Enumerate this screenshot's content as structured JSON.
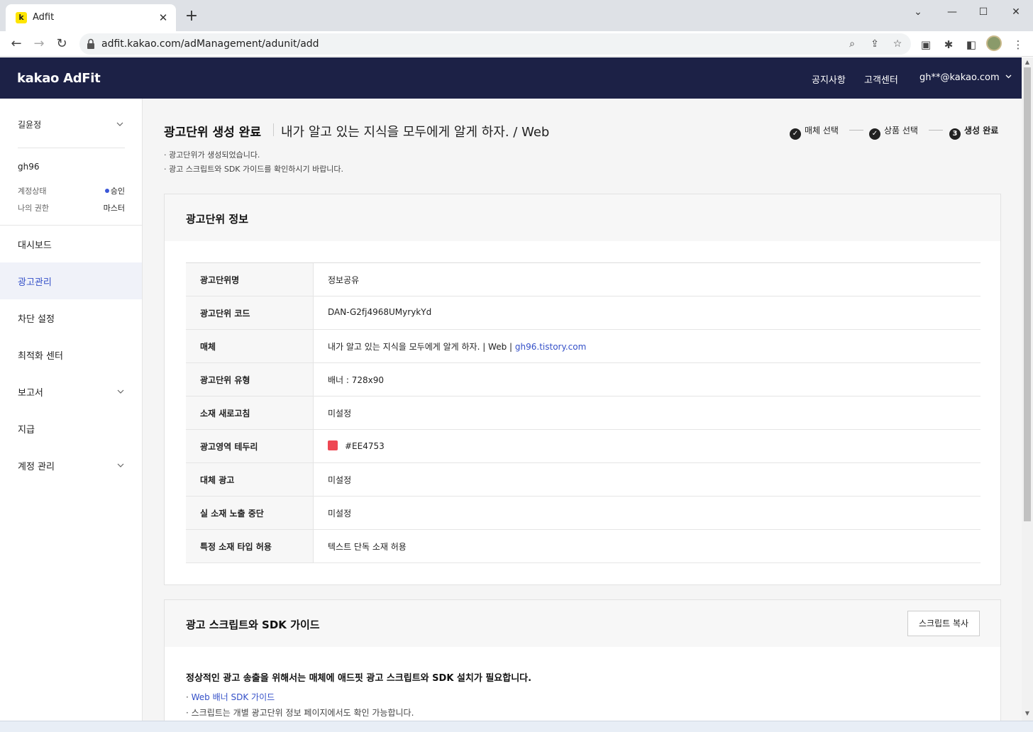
{
  "browser": {
    "tab_title": "Adfit",
    "tab_favicon": "k",
    "url": "adfit.kakao.com/adManagement/adunit/add"
  },
  "header": {
    "logo": "kakao AdFit",
    "notice_link": "공지사항",
    "support_link": "고객센터",
    "user_email": "gh**@kakao.com"
  },
  "sidebar": {
    "account_name": "길윤정",
    "user_id": "gh96",
    "status_label": "계정상태",
    "status_value": "승인",
    "role_label": "나의 권한",
    "role_value": "마스터",
    "menu": [
      {
        "label": "대시보드"
      },
      {
        "label": "광고관리"
      },
      {
        "label": "차단 설정"
      },
      {
        "label": "최적화 센터"
      },
      {
        "label": "보고서"
      },
      {
        "label": "지급"
      },
      {
        "label": "계정 관리"
      }
    ]
  },
  "page": {
    "title": "광고단위 생성 완료",
    "subtitle": "내가 알고 있는 지식을 모두에게 알게 하자. / Web",
    "steps": [
      {
        "label": "매체 선택",
        "marker": "✓"
      },
      {
        "label": "상품 선택",
        "marker": "✓"
      },
      {
        "label": "생성 완료",
        "marker": "3"
      }
    ],
    "notices": [
      "광고단위가 생성되었습니다.",
      "광고 스크립트와 SDK 가이드를 확인하시기 바랍니다."
    ]
  },
  "info_card": {
    "title": "광고단위 정보",
    "rows": [
      {
        "label": "광고단위명",
        "value": "정보공유"
      },
      {
        "label": "광고단위 코드",
        "value": "DAN-G2fj4968UMyrykYd"
      },
      {
        "label": "매체",
        "value": "내가 알고 있는 지식을 모두에게 알게 하자. | Web | ",
        "link": "gh96.tistory.com"
      },
      {
        "label": "광고단위 유형",
        "value": "배너 : 728x90"
      },
      {
        "label": "소재 새로고침",
        "value": "미설정"
      },
      {
        "label": "광고영역 테두리",
        "value": "#EE4753"
      },
      {
        "label": "대체 광고",
        "value": "미설정"
      },
      {
        "label": "실 소재 노출 중단",
        "value": "미설정"
      },
      {
        "label": "특정 소재 타입 허용",
        "value": "텍스트 단독 소재 허용"
      }
    ],
    "border_color": "#EE4753"
  },
  "guide_card": {
    "title": "광고 스크립트와 SDK 가이드",
    "copy_button": "스크립트 복사",
    "lead": "정상적인 광고 송출을 위해서는 매체에 애드핏 광고 스크립트와 SDK 설치가 필요합니다.",
    "sdk_link": "Web 배너 SDK 가이드",
    "note": "스크립트는 개별 광고단위 정보 페이지에서도 확인 가능합니다."
  },
  "colors": {
    "header_bg": "#1c2146",
    "accent": "#3450c8"
  }
}
